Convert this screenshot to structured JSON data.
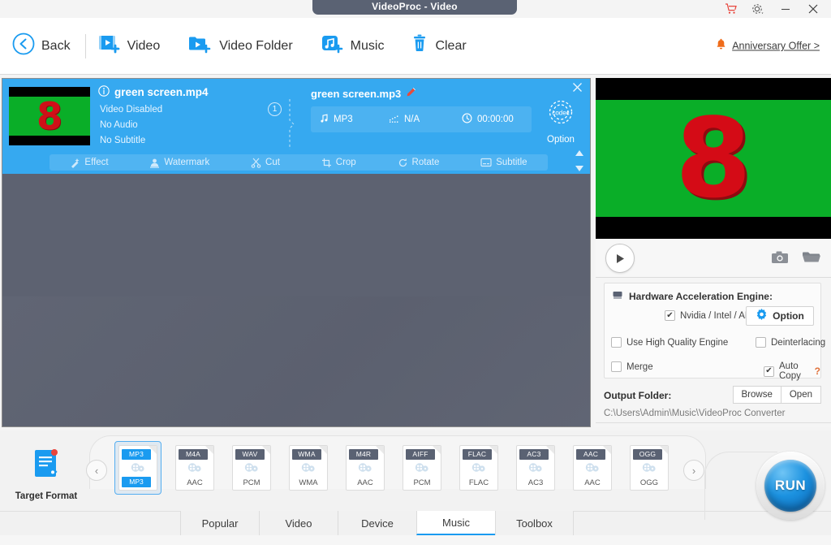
{
  "window": {
    "title": "VideoProc - Video",
    "controls": [
      {
        "name": "cart-icon",
        "glyph": "cart"
      },
      {
        "name": "settings-gear-icon",
        "glyph": "gear"
      },
      {
        "name": "minimize-button",
        "glyph": "minimize"
      },
      {
        "name": "close-button",
        "glyph": "close"
      }
    ]
  },
  "toolbar": {
    "back_label": "Back",
    "video_label": "Video",
    "video_folder_label": "Video Folder",
    "music_label": "Music",
    "clear_label": "Clear",
    "promo_label": "Anniversary Offer >",
    "accent": "#1a9bf0",
    "promo_color": "#ef6c1a"
  },
  "file_item": {
    "source_name": "green screen.mp4",
    "source_lines": [
      "Video Disabled",
      "No Audio",
      "No Subtitle"
    ],
    "count_badge": "1",
    "output_name": "green screen.mp3",
    "output_format": "MP3",
    "output_resolution": "N/A",
    "output_duration": "00:00:00",
    "codec_option_label": "Option",
    "codec_badge": "codec",
    "edit_tools": [
      "Effect",
      "Watermark",
      "Cut",
      "Crop",
      "Rotate",
      "Subtitle"
    ],
    "card_color": "#36a9f0"
  },
  "preview": {
    "thumb_digit": "8",
    "green": "#0aae28",
    "red": "#d40b16"
  },
  "settings": {
    "hardware_title": "Hardware Acceleration Engine:",
    "nvidia_label": "Nvidia / Intel / AMD",
    "nvidia_checked": true,
    "option_button": "Option",
    "high_quality_label": "Use High Quality Engine",
    "high_quality_checked": false,
    "deinterlacing_label": "Deinterlacing",
    "deinterlacing_checked": false,
    "merge_label": "Merge",
    "merge_checked": false,
    "auto_copy_label": "Auto Copy",
    "auto_copy_checked": true,
    "auto_copy_help": "?",
    "output_folder_title": "Output Folder:",
    "output_folder_path": "C:\\Users\\Admin\\Music\\VideoProc Converter",
    "browse_label": "Browse",
    "open_label": "Open"
  },
  "formats": {
    "target_format_label": "Target Format",
    "prev_label": "‹",
    "next_label": "›",
    "items": [
      {
        "top": "MP3",
        "bottom": "MP3",
        "selected": true
      },
      {
        "top": "M4A",
        "bottom": "AAC",
        "selected": false
      },
      {
        "top": "WAV",
        "bottom": "PCM",
        "selected": false
      },
      {
        "top": "WMA",
        "bottom": "WMA",
        "selected": false
      },
      {
        "top": "M4R",
        "bottom": "AAC",
        "selected": false
      },
      {
        "top": "AIFF",
        "bottom": "PCM",
        "selected": false
      },
      {
        "top": "FLAC",
        "bottom": "FLAC",
        "selected": false
      },
      {
        "top": "AC3",
        "bottom": "AC3",
        "selected": false
      },
      {
        "top": "AAC",
        "bottom": "AAC",
        "selected": false
      },
      {
        "top": "OGG",
        "bottom": "OGG",
        "selected": false
      }
    ]
  },
  "tabs": [
    {
      "label": "Popular",
      "active": false
    },
    {
      "label": "Video",
      "active": false
    },
    {
      "label": "Device",
      "active": false
    },
    {
      "label": "Music",
      "active": true
    },
    {
      "label": "Toolbox",
      "active": false
    }
  ],
  "run": {
    "label": "RUN"
  }
}
